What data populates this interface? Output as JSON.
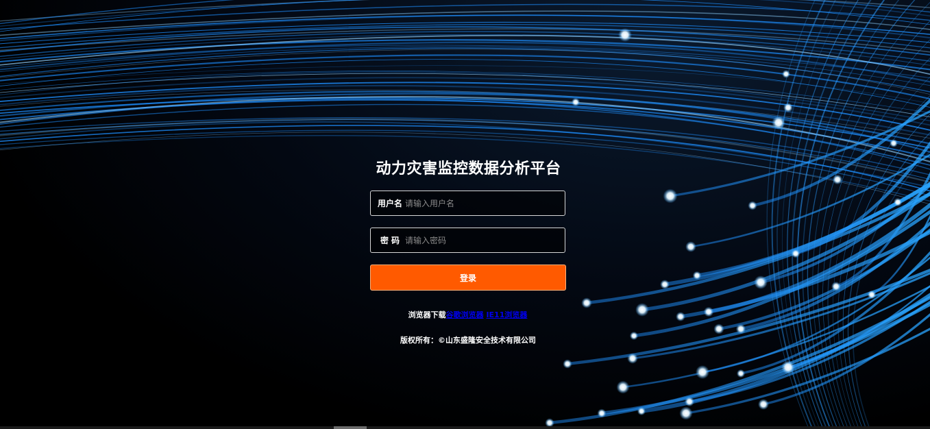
{
  "page": {
    "title": "动力灾害监控数据分析平台"
  },
  "login": {
    "username_label": "用户名",
    "username_placeholder": "请输入用户名",
    "password_label": "密码",
    "password_placeholder": "请输入密码",
    "submit_label": "登录"
  },
  "footer": {
    "download_prefix": "浏览器下载",
    "link_chrome": "谷歌浏览器",
    "link_ie11": "IE11浏览器",
    "copyright": "版权所有：©山东盛隆安全技术有限公司"
  },
  "colors": {
    "accent": "#ff5a00",
    "background": "#000000",
    "fiber_blue": "#1e8fff",
    "text": "#ffffff",
    "link": "#0000ee"
  }
}
